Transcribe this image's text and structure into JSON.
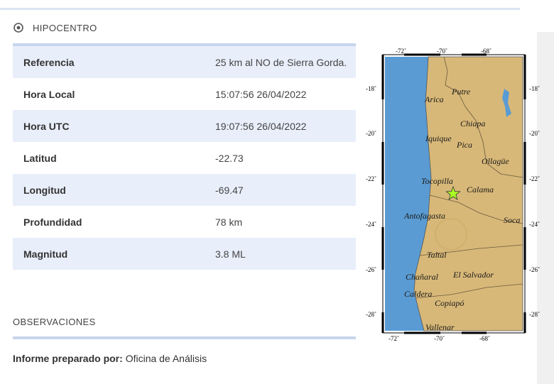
{
  "section": {
    "title": "HIPOCENTRO",
    "icon": "target-icon"
  },
  "rows": [
    {
      "label": "Referencia",
      "value": "25 km al NO de Sierra Gorda."
    },
    {
      "label": "Hora Local",
      "value": "15:07:56 26/04/2022"
    },
    {
      "label": "Hora UTC",
      "value": "19:07:56 26/04/2022"
    },
    {
      "label": "Latitud",
      "value": "-22.73"
    },
    {
      "label": "Longitud",
      "value": "-69.47"
    },
    {
      "label": "Profundidad",
      "value": "78 km"
    },
    {
      "label": "Magnitud",
      "value": "3.8 ML"
    }
  ],
  "observations": {
    "title": "OBSERVACIONES"
  },
  "report": {
    "label": "Informe preparado por:",
    "value": "Oficina de Análisis"
  },
  "map": {
    "lon_ticks": [
      "-72˚",
      "-70˚",
      "-68˚"
    ],
    "lat_ticks": [
      "-18˚",
      "-20˚",
      "-22˚",
      "-24˚",
      "-26˚",
      "-28˚"
    ],
    "places": [
      "Putre",
      "Arica",
      "Chiapa",
      "Iquique",
      "Pica",
      "Ollagüe",
      "Tocopilla",
      "Calama",
      "Antofagasta",
      "Soca",
      "Taltal",
      "Chañaral",
      "El Salvador",
      "Caldera",
      "Copiapó",
      "Vallenar"
    ],
    "colors": {
      "sea": "#5a9bd3",
      "land": "#d8b878",
      "epicenter": "#aaff22"
    }
  }
}
